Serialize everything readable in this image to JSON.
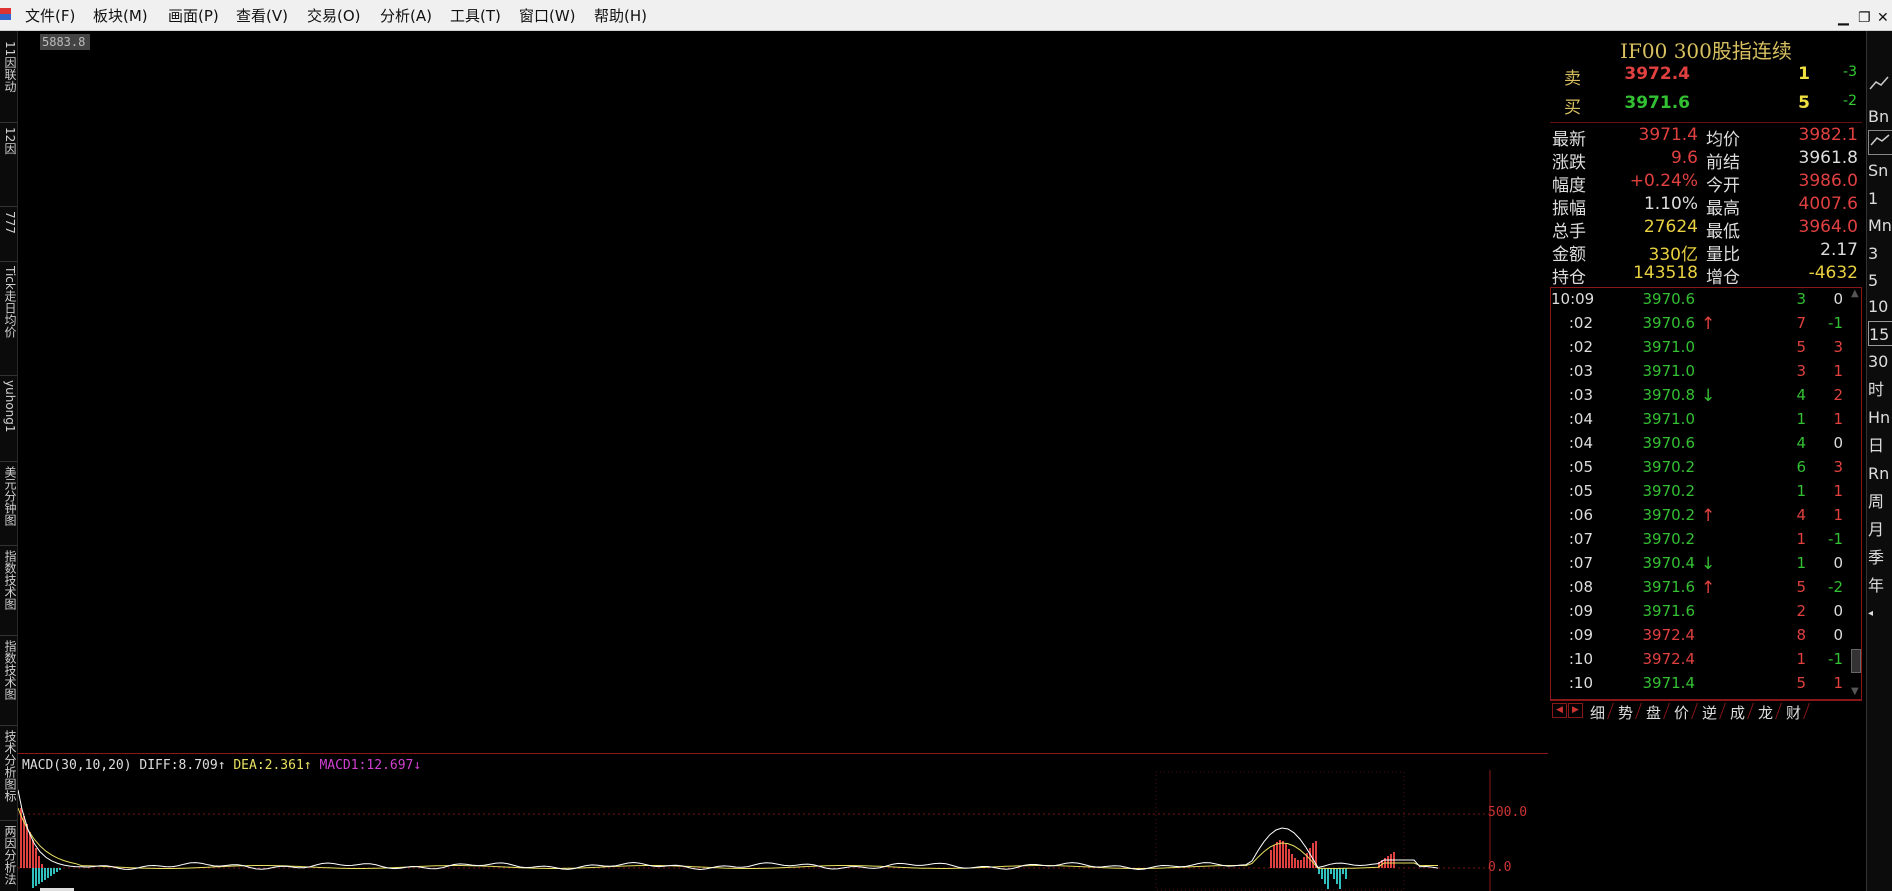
{
  "menu": [
    "文件(F)",
    "板块(M)",
    "画面(P)",
    "查看(V)",
    "交易(O)",
    "分析(A)",
    "工具(T)",
    "窗口(W)",
    "帮助(H)"
  ],
  "window_controls": {
    "minimize": "▁",
    "restore": "❐",
    "close": "✕"
  },
  "left_tabs": [
    "11因联动",
    "12因",
    "777",
    "Tick走日均价",
    "yuhong1",
    "美元分钟图",
    "指数技术图",
    "指数技术图",
    "技术分析图标",
    "两因分析法"
  ],
  "price_label": "5883.8",
  "quote": {
    "title": "IF00   300股指连续",
    "sell": {
      "label": "卖",
      "price": "3972.4",
      "qty": "1",
      "chg": "-3"
    },
    "buy": {
      "label": "买",
      "price": "3971.6",
      "qty": "5",
      "chg": "-2"
    },
    "stats": [
      {
        "l1": "最新",
        "v1": "3971.4",
        "c1": "#e04040",
        "l2": "均价",
        "v2": "3982.1",
        "c2": "#e04040"
      },
      {
        "l1": "涨跌",
        "v1": "9.6",
        "c1": "#e04040",
        "l2": "前结",
        "v2": "3961.8",
        "c2": "#dddddd"
      },
      {
        "l1": "幅度",
        "v1": "+0.24%",
        "c1": "#e04040",
        "l2": "今开",
        "v2": "3986.0",
        "c2": "#e04040"
      },
      {
        "l1": "振幅",
        "v1": "1.10%",
        "c1": "#dddddd",
        "l2": "最高",
        "v2": "4007.6",
        "c2": "#e04040"
      },
      {
        "l1": "总手",
        "v1": "27624",
        "c1": "#e8d040",
        "l2": "最低",
        "v2": "3964.0",
        "c2": "#e04040"
      },
      {
        "l1": "金额",
        "v1": "330亿",
        "c1": "#e8d040",
        "l2": "量比",
        "v2": "2.17",
        "c2": "#dddddd"
      },
      {
        "l1": "持仓",
        "v1": "143518",
        "c1": "#e8d040",
        "l2": "增仓",
        "v2": "-4632",
        "c2": "#e8d040"
      }
    ]
  },
  "ticks": [
    {
      "time": "10:09",
      "price": "3970.6",
      "pc": "#33c033",
      "arrow": "",
      "ac": "",
      "qty": "3",
      "qc": "#33c033",
      "chg": "0",
      "cc": "#dddddd"
    },
    {
      "time": ":02",
      "price": "3970.6",
      "pc": "#33c033",
      "arrow": "↑",
      "ac": "#e04040",
      "qty": "7",
      "qc": "#e04040",
      "chg": "-1",
      "cc": "#33c033"
    },
    {
      "time": ":02",
      "price": "3971.0",
      "pc": "#33c033",
      "arrow": "",
      "ac": "",
      "qty": "5",
      "qc": "#e04040",
      "chg": "3",
      "cc": "#e04040"
    },
    {
      "time": ":03",
      "price": "3971.0",
      "pc": "#33c033",
      "arrow": "",
      "ac": "",
      "qty": "3",
      "qc": "#e04040",
      "chg": "1",
      "cc": "#e04040"
    },
    {
      "time": ":03",
      "price": "3970.8",
      "pc": "#33c033",
      "arrow": "↓",
      "ac": "#33c033",
      "qty": "4",
      "qc": "#33c033",
      "chg": "2",
      "cc": "#e04040"
    },
    {
      "time": ":04",
      "price": "3971.0",
      "pc": "#33c033",
      "arrow": "",
      "ac": "",
      "qty": "1",
      "qc": "#33c033",
      "chg": "1",
      "cc": "#e04040"
    },
    {
      "time": ":04",
      "price": "3970.6",
      "pc": "#33c033",
      "arrow": "",
      "ac": "",
      "qty": "4",
      "qc": "#33c033",
      "chg": "0",
      "cc": "#dddddd"
    },
    {
      "time": ":05",
      "price": "3970.2",
      "pc": "#33c033",
      "arrow": "",
      "ac": "",
      "qty": "6",
      "qc": "#33c033",
      "chg": "3",
      "cc": "#e04040"
    },
    {
      "time": ":05",
      "price": "3970.2",
      "pc": "#33c033",
      "arrow": "",
      "ac": "",
      "qty": "1",
      "qc": "#33c033",
      "chg": "1",
      "cc": "#e04040"
    },
    {
      "time": ":06",
      "price": "3970.2",
      "pc": "#33c033",
      "arrow": "↑",
      "ac": "#e04040",
      "qty": "4",
      "qc": "#e04040",
      "chg": "1",
      "cc": "#e04040"
    },
    {
      "time": ":07",
      "price": "3970.2",
      "pc": "#33c033",
      "arrow": "",
      "ac": "",
      "qty": "1",
      "qc": "#e04040",
      "chg": "-1",
      "cc": "#33c033"
    },
    {
      "time": ":07",
      "price": "3970.4",
      "pc": "#33c033",
      "arrow": "↓",
      "ac": "#33c033",
      "qty": "1",
      "qc": "#33c033",
      "chg": "0",
      "cc": "#dddddd"
    },
    {
      "time": ":08",
      "price": "3971.6",
      "pc": "#33c033",
      "arrow": "↑",
      "ac": "#e04040",
      "qty": "5",
      "qc": "#e04040",
      "chg": "-2",
      "cc": "#33c033"
    },
    {
      "time": ":09",
      "price": "3971.6",
      "pc": "#33c033",
      "arrow": "",
      "ac": "",
      "qty": "2",
      "qc": "#e04040",
      "chg": "0",
      "cc": "#dddddd"
    },
    {
      "time": ":09",
      "price": "3972.4",
      "pc": "#e04040",
      "arrow": "",
      "ac": "",
      "qty": "8",
      "qc": "#e04040",
      "chg": "0",
      "cc": "#dddddd"
    },
    {
      "time": ":10",
      "price": "3972.4",
      "pc": "#e04040",
      "arrow": "",
      "ac": "",
      "qty": "1",
      "qc": "#e04040",
      "chg": "-1",
      "cc": "#33c033"
    },
    {
      "time": ":10",
      "price": "3971.4",
      "pc": "#33c033",
      "arrow": "",
      "ac": "",
      "qty": "5",
      "qc": "#e04040",
      "chg": "1",
      "cc": "#e04040"
    }
  ],
  "panel_tabs": [
    "细",
    "势",
    "盘",
    "价",
    "逆",
    "成",
    "龙",
    "财"
  ],
  "periods": [
    "Bn",
    "Sn",
    "1",
    "Mn",
    "3",
    "5",
    "10",
    "15",
    "30",
    "时",
    "Hn",
    "日",
    "Rn",
    "周",
    "月",
    "季",
    "年"
  ],
  "selected_period": "15",
  "macd": {
    "name": "MACD(30,10,20)",
    "diff": "DIFF:8.709",
    "diff_arrow": "↑",
    "dea": "DEA:2.361",
    "dea_arrow": "↑",
    "macd1": "MACD1:12.697",
    "macd1_arrow": "↓",
    "axis": [
      "500.0",
      "0.0"
    ]
  },
  "colors": {
    "up": "#e04040",
    "down": "#33c033",
    "diff": "#ffffff",
    "dea": "#e8e060",
    "macd1": "#d040d0",
    "border": "#8a1818"
  }
}
